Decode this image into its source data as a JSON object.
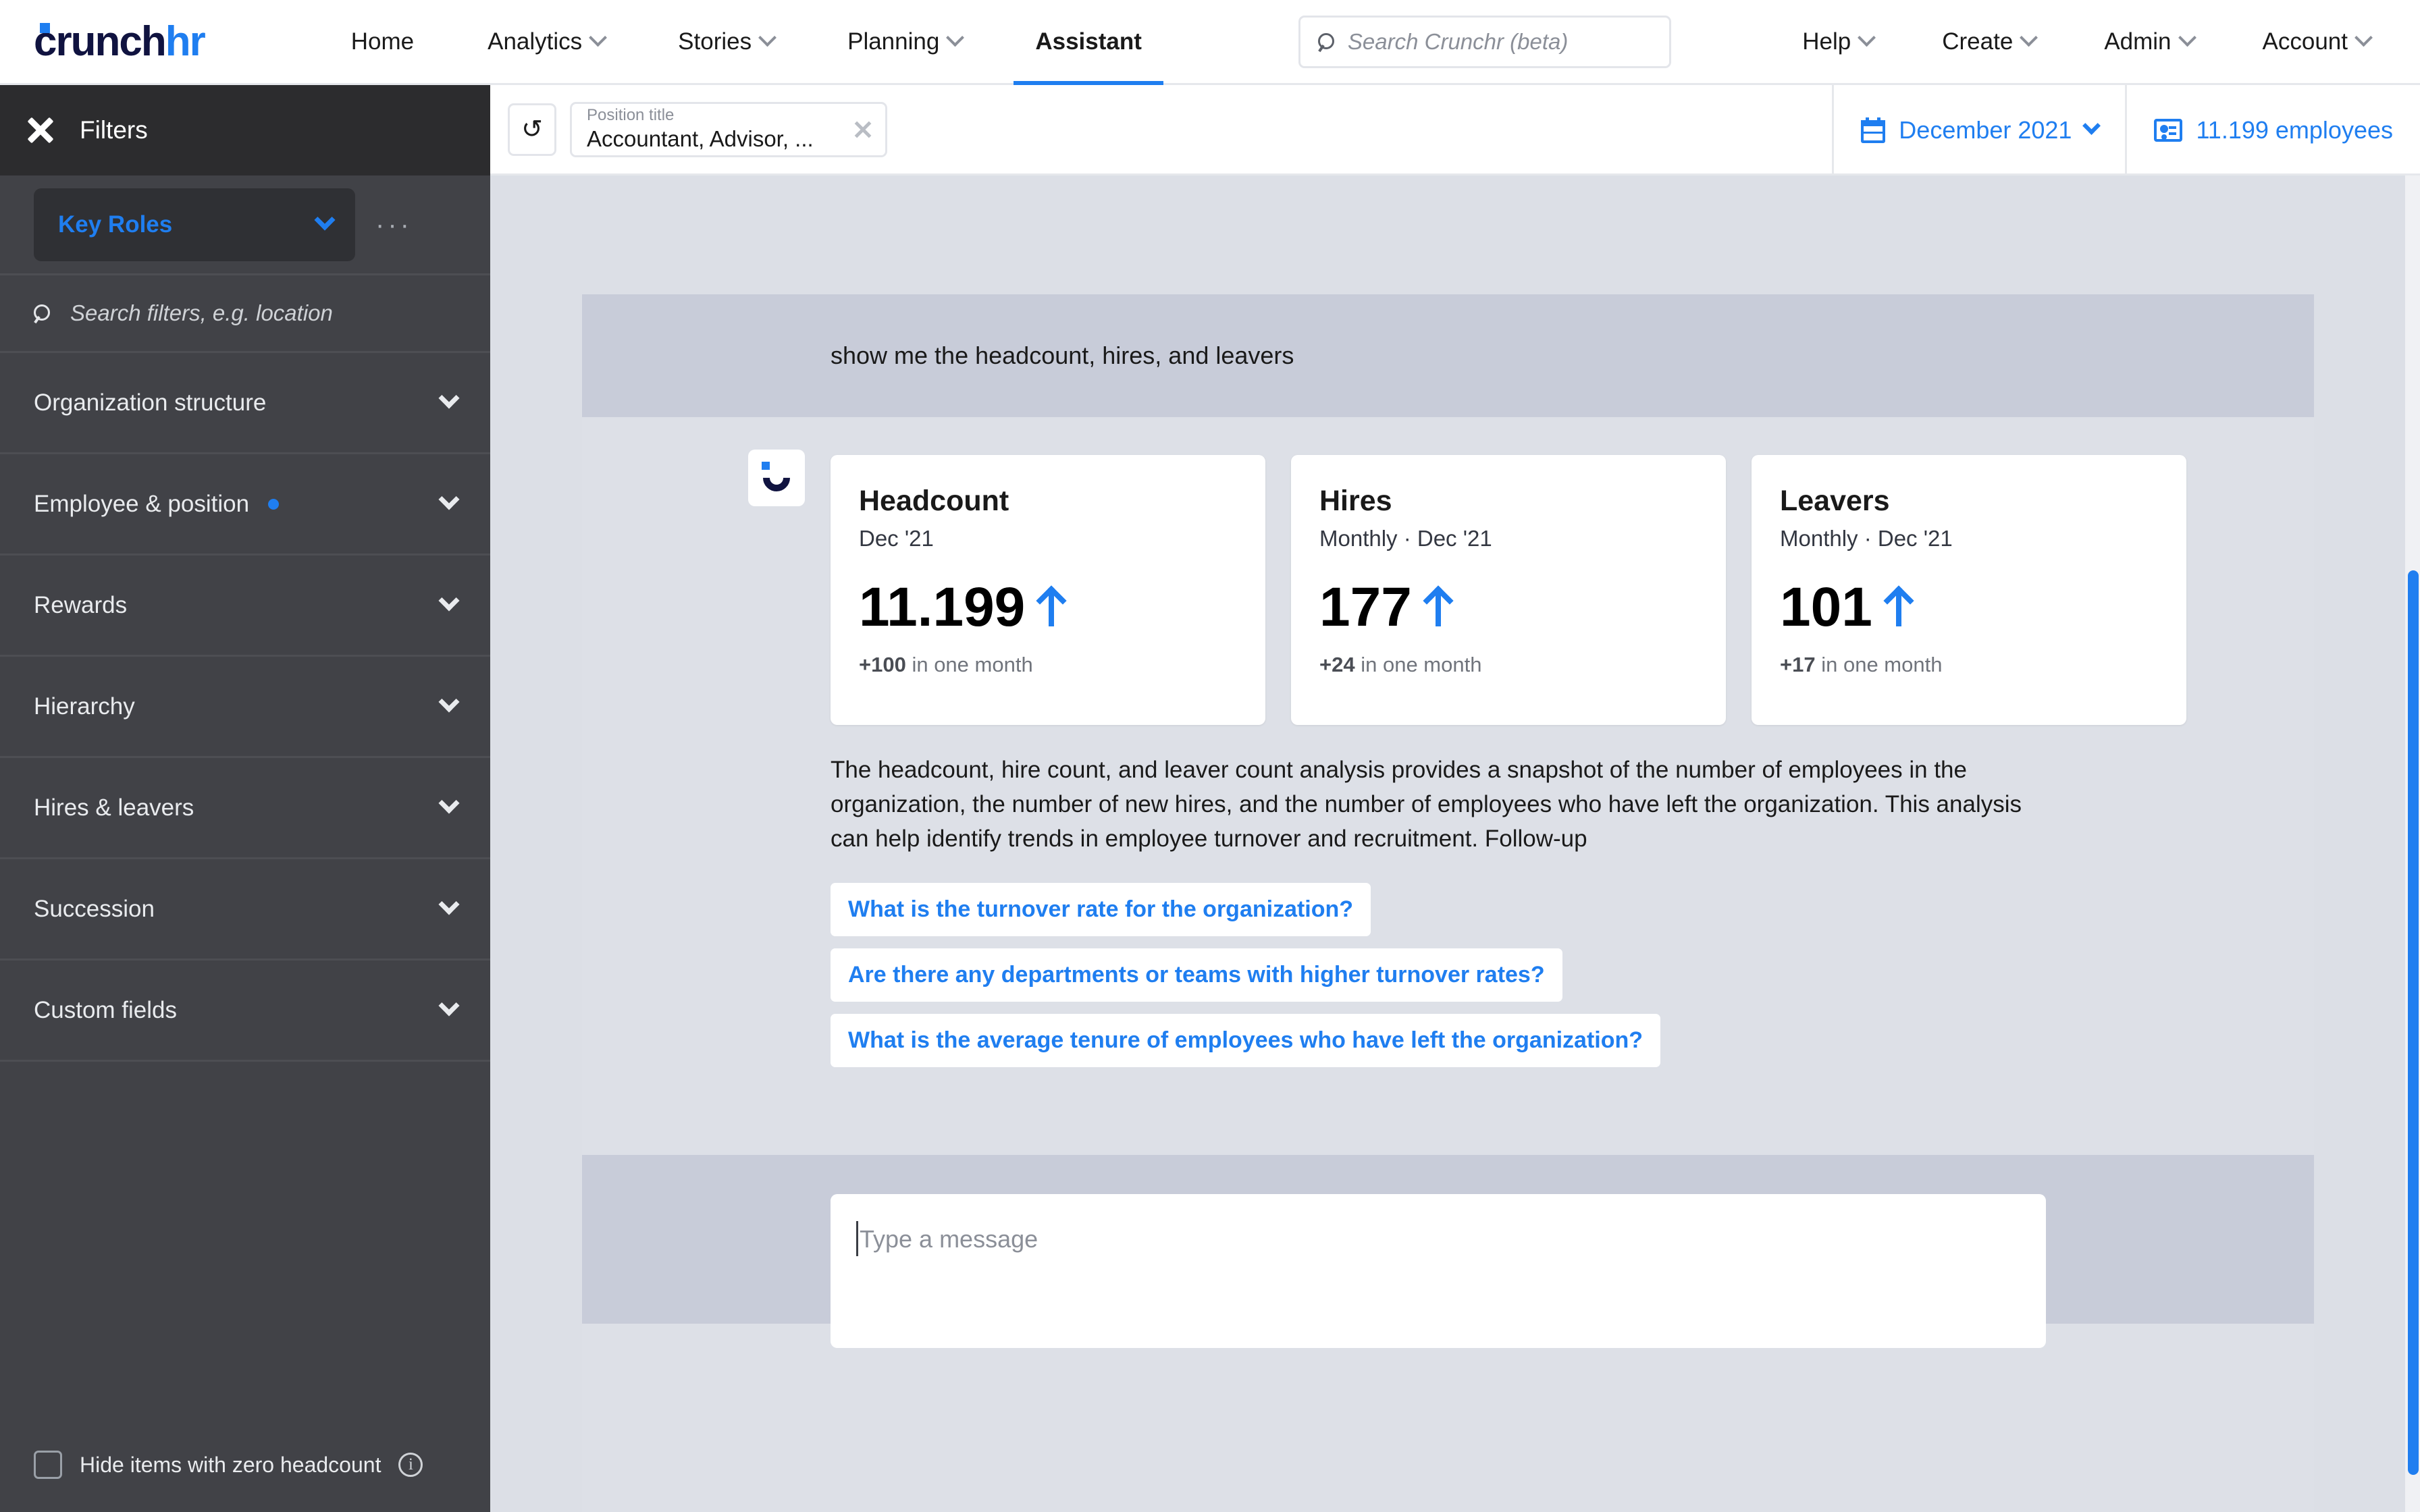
{
  "brand": {
    "logo_dark": "crunch",
    "logo_blue": "hr",
    "accent_color": "#1f7ef0",
    "logo_dark_color": "#101340"
  },
  "topnav": {
    "main_items": [
      {
        "label": "Home",
        "has_chevron": false,
        "active": false
      },
      {
        "label": "Analytics",
        "has_chevron": true,
        "active": false
      },
      {
        "label": "Stories",
        "has_chevron": true,
        "active": false
      },
      {
        "label": "Planning",
        "has_chevron": true,
        "active": false
      },
      {
        "label": "Assistant",
        "has_chevron": false,
        "active": true
      }
    ],
    "search": {
      "placeholder": "Search Crunchr (beta)",
      "value": "",
      "icon": "search-icon"
    },
    "right_items": [
      {
        "label": "Help",
        "has_chevron": true
      },
      {
        "label": "Create",
        "has_chevron": true
      },
      {
        "label": "Admin",
        "has_chevron": true
      },
      {
        "label": "Account",
        "has_chevron": true
      }
    ]
  },
  "filterbar": {
    "toggle_label": "Filters",
    "toggle_icon": "close-icon",
    "reset_icon": "reset-filters-icon",
    "reset_glyph": "↺",
    "chip": {
      "label": "Position title",
      "value": "Accountant, Advisor, ...",
      "remove_icon": "close-icon"
    },
    "period": {
      "label": "December 2021",
      "icon": "calendar-icon",
      "chevron": "chevron-down-icon"
    },
    "employees": {
      "label": "11.199 employees",
      "icon": "id-badge-icon"
    }
  },
  "sidebar": {
    "key_roles": {
      "label": "Key Roles",
      "chevron": "chevron-down-icon"
    },
    "more_menu": "···",
    "search": {
      "placeholder": "Search filters, e.g. location",
      "value": "",
      "icon": "search-icon"
    },
    "items": [
      {
        "label": "Organization structure",
        "has_dot": false
      },
      {
        "label": "Employee & position",
        "has_dot": true
      },
      {
        "label": "Rewards",
        "has_dot": false
      },
      {
        "label": "Hierarchy",
        "has_dot": false
      },
      {
        "label": "Hires & leavers",
        "has_dot": false
      },
      {
        "label": "Succession",
        "has_dot": false
      },
      {
        "label": "Custom fields",
        "has_dot": false
      }
    ],
    "hide_zero": {
      "label": "Hide items with zero headcount",
      "checked": false,
      "info_glyph": "i"
    }
  },
  "chat": {
    "user_message": "show me the headcount, hires, and leavers",
    "assistant_avatar": "crunchr-avatar-icon",
    "cards": [
      {
        "title": "Headcount",
        "subtitle": "Dec '21",
        "value": "11.199",
        "trend": "up",
        "delta": "+100",
        "delta_suffix": "in one month"
      },
      {
        "title": "Hires",
        "subtitle": "Monthly · Dec '21",
        "value": "177",
        "trend": "up",
        "delta": "+24",
        "delta_suffix": "in one month"
      },
      {
        "title": "Leavers",
        "subtitle": "Monthly · Dec '21",
        "value": "101",
        "trend": "up",
        "delta": "+17",
        "delta_suffix": "in one month"
      }
    ],
    "assistant_text": "The headcount, hire count, and leaver count analysis provides a snapshot of the number of employees in the organization, the number of new hires, and the number of employees who have left the organization. This analysis can help identify trends in employee turnover and recruitment. Follow-up",
    "suggestions": [
      "What is the turnover rate for the organization?",
      "Are there any departments or teams with higher turnover rates?",
      "What is the average tenure of employees who have left the organization?"
    ],
    "composer": {
      "placeholder": "Type a message",
      "value": ""
    }
  }
}
